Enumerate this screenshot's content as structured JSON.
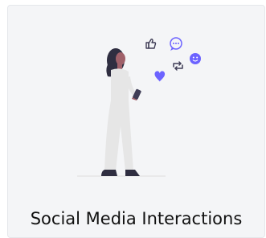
{
  "card": {
    "title": "Social Media Interactions",
    "illustration_icons": [
      "thumbs-up-icon",
      "chat-bubble-icon",
      "smiley-icon",
      "heart-icon",
      "repost-icon"
    ],
    "accent_color": "#6c63ff"
  }
}
